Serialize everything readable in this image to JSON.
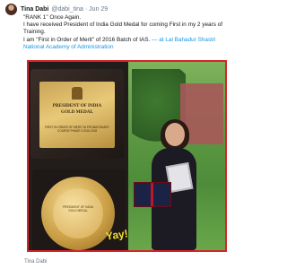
{
  "tweet": {
    "author": "Tina Dabi",
    "handle": "@dabi_tina",
    "separator": "·",
    "date": "Jun 29",
    "lines": [
      "\"RANK 1\" Once Again.",
      "I have received President of India Gold Medal for coming First in my 2 years of Training.",
      "I am \"First in Order of Merit\" of 2016 Batch of IAS."
    ],
    "location_link": "— at Lal Bahadur Shastri National Academy of Administration"
  },
  "media": {
    "plaque_line1": "PRESIDENT OF INDIA",
    "plaque_line2": "GOLD MEDAL",
    "plaque_sub": "FIRST IN ORDER OF MERIT IN PROBATIONARY COURSE PHASE II 2016-2018",
    "medal_text": "PRESIDENT OF INDIA GOLD MEDAL",
    "watermark": "Yay!"
  },
  "footer": {
    "caption": "Tina Dabi"
  },
  "colors": {
    "link": "#1b95e0",
    "frame_border": "#d9222a",
    "watermark": "#f2e02d"
  }
}
